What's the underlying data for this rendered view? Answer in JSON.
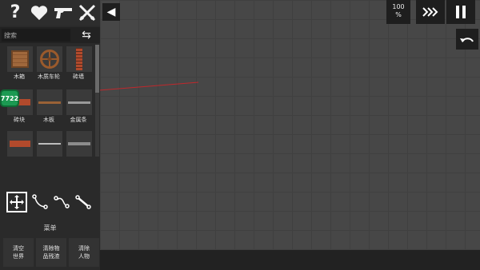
{
  "top_icons": [
    "question-icon",
    "heart-icon",
    "gun-icon",
    "crossed-swords-icon"
  ],
  "search": {
    "placeholder": "搜索"
  },
  "items": [
    {
      "label": "木箱",
      "icon": "crate"
    },
    {
      "label": "木质车轮",
      "icon": "wheel"
    },
    {
      "label": "砖墙",
      "icon": "brickwall"
    },
    {
      "label": "砖块",
      "icon": "brick"
    },
    {
      "label": "木板",
      "icon": "plank"
    },
    {
      "label": "金属条",
      "icon": "metal"
    },
    {
      "label": "",
      "icon": "brick"
    },
    {
      "label": "",
      "icon": "rod"
    },
    {
      "label": "",
      "icon": "bar2"
    }
  ],
  "badge_text": "7722",
  "menu_label": "菜单",
  "actions": [
    {
      "label": "清空\n世界"
    },
    {
      "label": "清除物\n品残渣"
    },
    {
      "label": "清除\n人物"
    }
  ],
  "zoom": {
    "value": "100",
    "unit": "%"
  },
  "colors": {
    "laser": "#c0282c",
    "badge": "#1c9a52"
  }
}
